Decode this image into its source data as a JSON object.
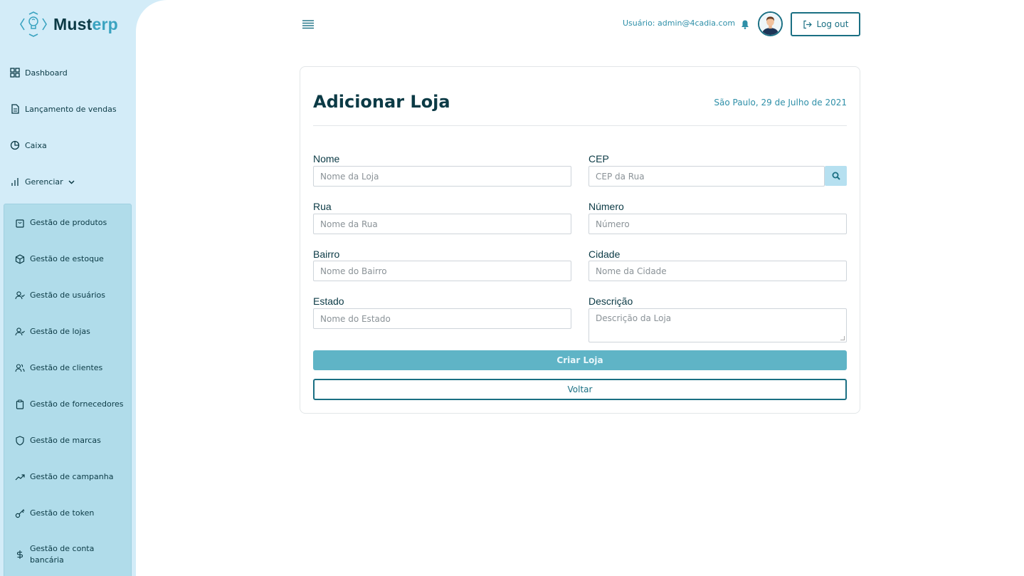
{
  "brand": {
    "name_main": "Must",
    "name_accent": "erp"
  },
  "colors": {
    "sidebar_bg": "#d3ecf8",
    "submenu_bg": "#b0dcea",
    "primary": "#5fb4c6",
    "accent": "#1a6f83",
    "text_dark": "#0b3a45"
  },
  "sidebar": {
    "items": [
      {
        "label": "Dashboard",
        "icon": "grid-icon"
      },
      {
        "label": "Lançamento de vendas",
        "icon": "document-icon"
      },
      {
        "label": "Caixa",
        "icon": "pie-chart-icon"
      },
      {
        "label": "Gerenciar",
        "icon": "bar-chart-icon"
      }
    ],
    "submenu": [
      {
        "label": "Gestão de produtos",
        "icon": "shopping-bag-icon"
      },
      {
        "label": "Gestão de estoque",
        "icon": "box-icon"
      },
      {
        "label": "Gestão de usuários",
        "icon": "user-check-icon"
      },
      {
        "label": "Gestão de lojas",
        "icon": "user-check-icon"
      },
      {
        "label": "Gestão de clientes",
        "icon": "users-icon"
      },
      {
        "label": "Gestão de fornecedores",
        "icon": "clipboard-icon"
      },
      {
        "label": "Gestão de marcas",
        "icon": "shield-icon"
      },
      {
        "label": "Gestão de campanha",
        "icon": "trending-up-icon"
      },
      {
        "label": "Gestão de token",
        "icon": "key-icon"
      },
      {
        "label": "Gestão de conta bancária",
        "icon": "dollar-icon"
      }
    ]
  },
  "header": {
    "user_label": "Usuário: admin@4cadia.com",
    "logout_label": "Log out"
  },
  "form": {
    "title": "Adicionar Loja",
    "date": "São Paulo, 29 de Julho de 2021",
    "fields": {
      "nome": {
        "label": "Nome",
        "placeholder": "Nome da Loja"
      },
      "cep": {
        "label": "CEP",
        "placeholder": "CEP da Rua"
      },
      "rua": {
        "label": "Rua",
        "placeholder": "Nome da Rua"
      },
      "numero": {
        "label": "Número",
        "placeholder": "Número"
      },
      "bairro": {
        "label": "Bairro",
        "placeholder": "Nome do Bairro"
      },
      "cidade": {
        "label": "Cidade",
        "placeholder": "Nome da Cidade"
      },
      "estado": {
        "label": "Estado",
        "placeholder": "Nome do Estado"
      },
      "descricao": {
        "label": "Descrição",
        "placeholder": "Descrição da Loja"
      }
    },
    "submit_label": "Criar Loja",
    "back_label": "Voltar"
  }
}
